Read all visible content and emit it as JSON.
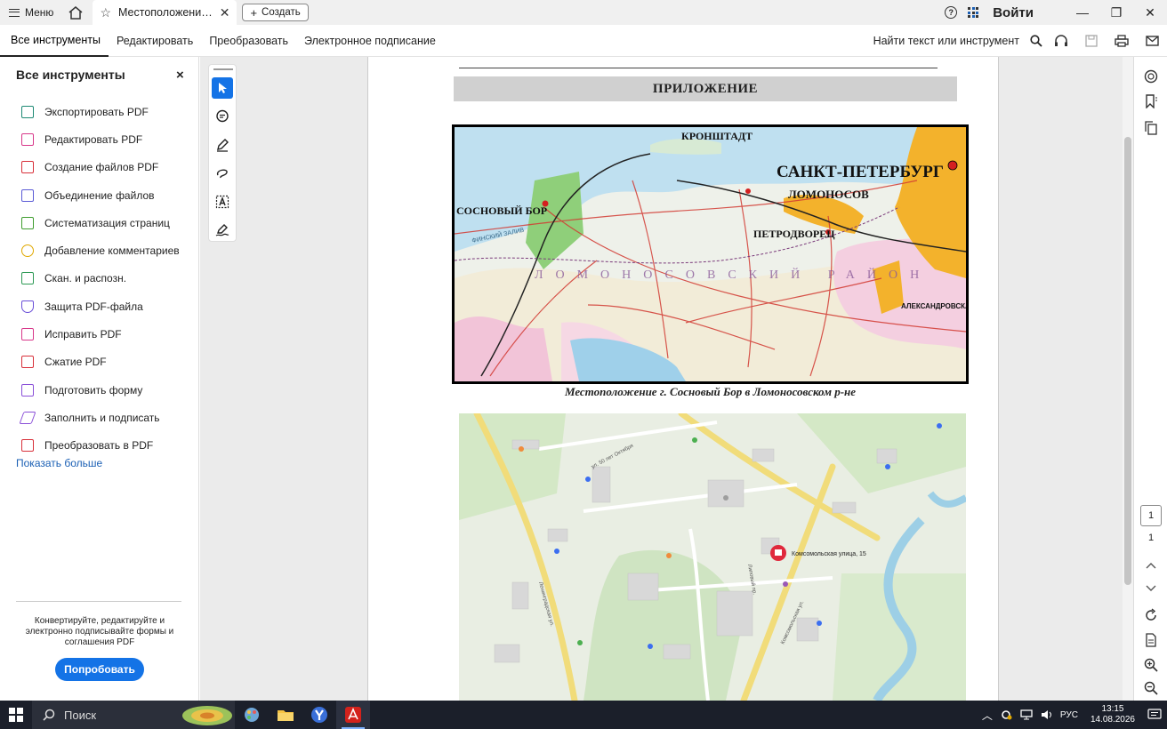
{
  "titlebar": {
    "menu_label": "Меню",
    "tab_title": "Местоположение л...",
    "create_label": "Создать",
    "help_symbol": "?",
    "signin_label": "Войти",
    "minimize_symbol": "—",
    "restore_symbol": "❐",
    "close_symbol": "✕"
  },
  "toolbar": {
    "tabs": [
      {
        "label": "Все инструменты"
      },
      {
        "label": "Редактировать"
      },
      {
        "label": "Преобразовать"
      },
      {
        "label": "Электронное подписание"
      }
    ],
    "find_label": "Найти текст или инструмент"
  },
  "left_panel": {
    "title": "Все инструменты",
    "close_symbol": "×",
    "items": [
      {
        "label": "Экспортировать PDF",
        "icon": "export-pdf-icon",
        "color": "#1e8a74"
      },
      {
        "label": "Редактировать PDF",
        "icon": "edit-pdf-icon",
        "color": "#d8388a"
      },
      {
        "label": "Создание файлов PDF",
        "icon": "create-pdf-icon",
        "color": "#d8303a"
      },
      {
        "label": "Объединение файлов",
        "icon": "combine-files-icon",
        "color": "#5b5bd6"
      },
      {
        "label": "Систематизация страниц",
        "icon": "organize-pages-icon",
        "color": "#3f9d2f"
      },
      {
        "label": "Добавление комментариев",
        "icon": "comment-icon",
        "color": "#e0a800"
      },
      {
        "label": "Скан. и распозн.",
        "icon": "scan-ocr-icon",
        "color": "#2e9a55"
      },
      {
        "label": "Защита PDF-файла",
        "icon": "protect-pdf-icon",
        "color": "#6a4fd8"
      },
      {
        "label": "Исправить PDF",
        "icon": "redact-pdf-icon",
        "color": "#d8388a"
      },
      {
        "label": "Сжатие PDF",
        "icon": "compress-pdf-icon",
        "color": "#d8303a"
      },
      {
        "label": "Подготовить форму",
        "icon": "prepare-form-icon",
        "color": "#8a4fd8"
      },
      {
        "label": "Заполнить и подписать",
        "icon": "fill-sign-icon",
        "color": "#8a4fd8"
      },
      {
        "label": "Преобразовать в PDF",
        "icon": "convert-to-pdf-icon",
        "color": "#d8303a"
      }
    ],
    "show_more": "Показать больше",
    "promo_text": "Конвертируйте, редактируйте и электронно подписывайте формы и соглашения PDF",
    "try_button": "Попробовать"
  },
  "document": {
    "heading": "ПРИЛОЖЕНИЕ",
    "caption": "Местоположение г. Сосновый Бор в Ломоносовском р-не",
    "map1_labels": {
      "kronshtadt": "КРОНШТАДТ",
      "spb": "САНКТ-ПЕТЕРБУРГ",
      "lomonosov": "ЛОМОНОСОВ",
      "sosnovy_bor": "СОСНОВЫЙ БОР",
      "petrodvorets": "ПЕТРОДВОРЕЦ",
      "district": "ЛОМОНОСОВСКИЙ РАЙОН",
      "alexandrovskaya": "АЛЕКСАНДРОВСКАЯ",
      "bay": "ФИНСКИЙ ЗАЛИВ"
    },
    "map2_labels": {
      "address": "Комсомольская улица, 15",
      "street1": "ул. 50 лет Октября",
      "street2": "Ленинградская ул.",
      "street3": "Комсомольская ул.",
      "street4": "Липовый пр."
    }
  },
  "right_rail": {
    "current_page": "1",
    "total_pages": "1"
  },
  "taskbar": {
    "search_label": "Поиск",
    "language": "РУС",
    "time": "13:15",
    "date": "14.08.2026"
  }
}
